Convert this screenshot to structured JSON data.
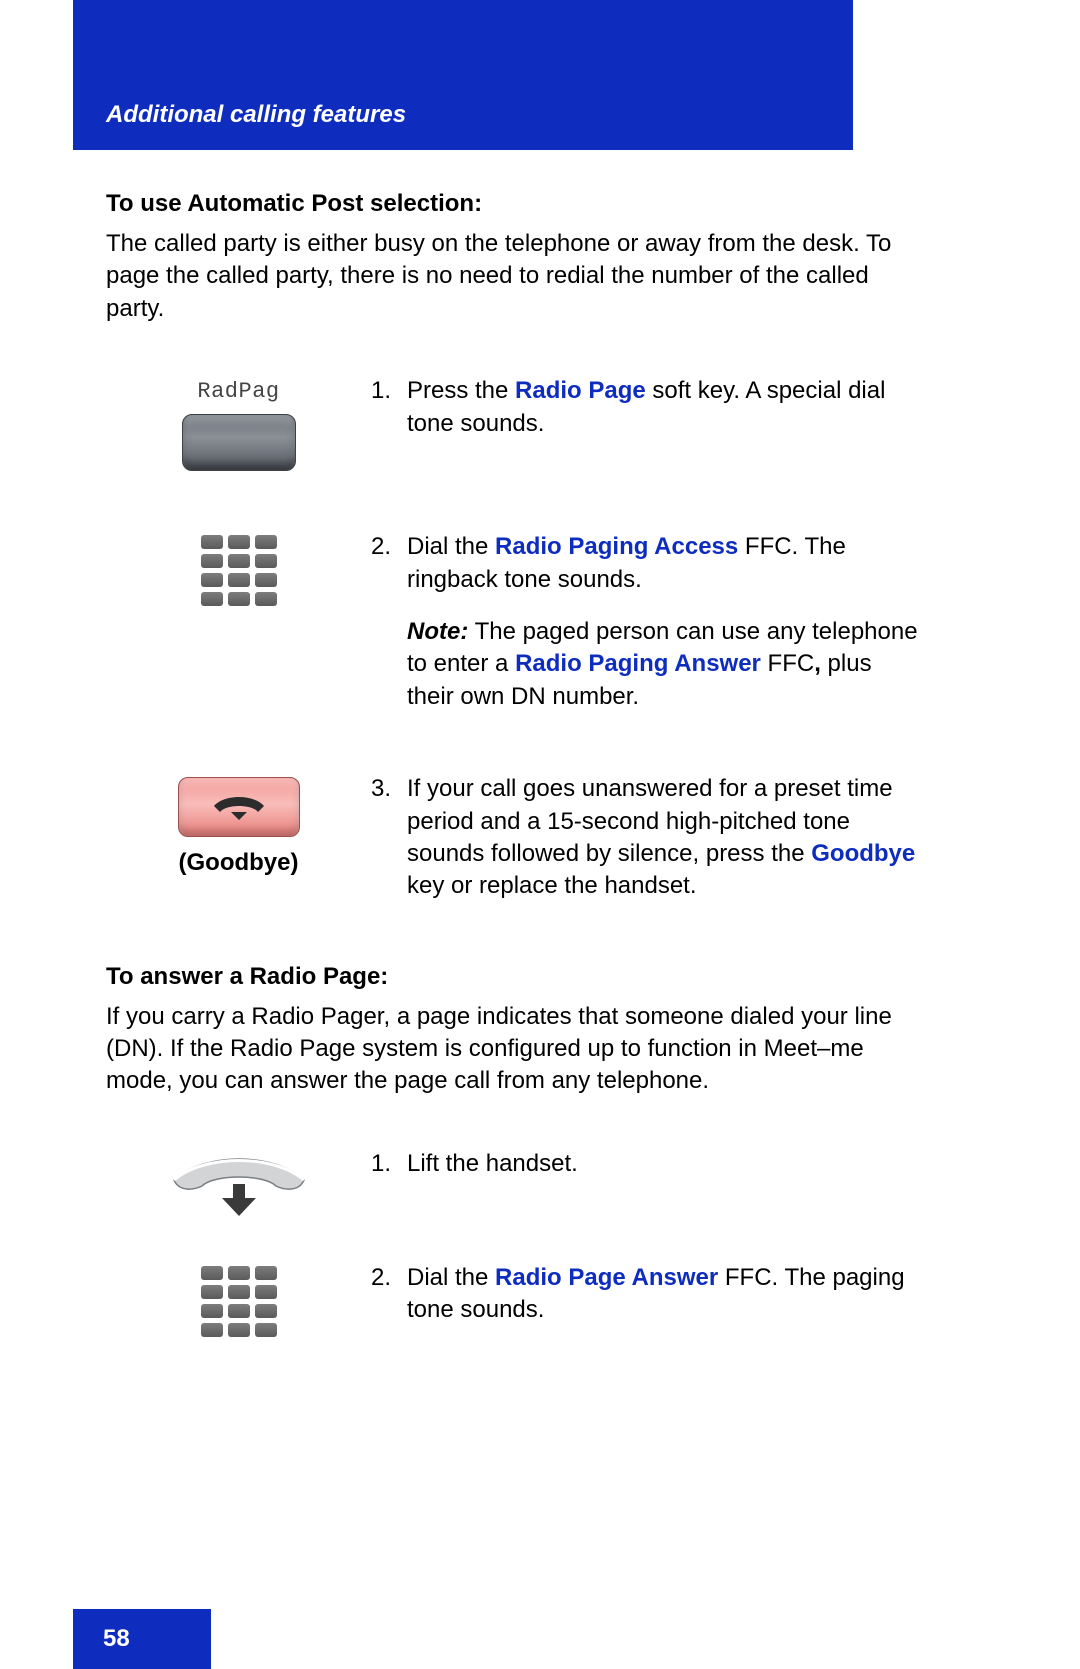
{
  "header": {
    "title": "Additional calling features"
  },
  "section1": {
    "heading": "To use Automatic Post selection:",
    "intro": "The called party is either busy on the telephone or away from the desk. To page the called party, there is no need to redial the number of the called party.",
    "steps": {
      "s1": {
        "num": "1.",
        "pre": "Press the ",
        "kw": "Radio Page",
        "post": " soft key. A special dial tone sounds.",
        "softkey_label": "RadPag"
      },
      "s2": {
        "num": "2.",
        "pre": "Dial the ",
        "kw": "Radio Paging Access",
        "post": " FFC. The ringback tone sounds.",
        "note_label": "Note:",
        "note_pre": " The paged person can use any telephone to enter a ",
        "note_kw": "Radio Paging Answer",
        "note_post1": " FFC",
        "note_comma": ",",
        "note_post2": " plus their own DN number."
      },
      "s3": {
        "num": "3.",
        "pre": "If your call goes unanswered for a preset time period and a 15-second high-pitched tone sounds followed by silence, press the ",
        "kw": "Goodbye",
        "post": " key or replace the handset.",
        "btn_label": "(Goodbye)"
      }
    }
  },
  "section2": {
    "heading": "To answer a Radio Page:",
    "intro": "If you carry a Radio Pager, a page indicates that someone dialed your line (DN). If the Radio Page system is configured up to function in Meet–me mode, you can answer the page call from any telephone.",
    "steps": {
      "s1": {
        "num": "1.",
        "text": "Lift the handset."
      },
      "s2": {
        "num": "2.",
        "pre": "Dial the ",
        "kw": "Radio Page Answer",
        "post": " FFC. The paging tone sounds."
      }
    }
  },
  "footer": {
    "page_number": "58"
  }
}
